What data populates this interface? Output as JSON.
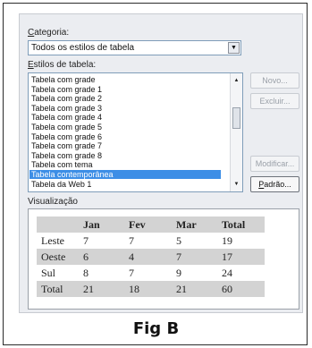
{
  "category": {
    "label_prefix": "",
    "label_mnemonic": "C",
    "label_rest": "ategoria:",
    "value": "Todos os estilos de tabela"
  },
  "styles": {
    "label_mnemonic": "E",
    "label_rest": "stilos de tabela:",
    "items": [
      "Tabela com grade",
      "Tabela com grade 1",
      "Tabela com grade 2",
      "Tabela com grade 3",
      "Tabela com grade 4",
      "Tabela com grade 5",
      "Tabela com grade 6",
      "Tabela com grade 7",
      "Tabela com grade 8",
      "Tabela com tema",
      "Tabela contemporânea",
      "Tabela da Web 1"
    ],
    "selected_index": 10
  },
  "buttons": {
    "novo": "Novo...",
    "excluir": "Excluir...",
    "modificar": "Modificar...",
    "padrao_mnemonic": "P",
    "padrao_rest": "adrão..."
  },
  "preview": {
    "label": "Visualização",
    "header": [
      "",
      "Jan",
      "Fev",
      "Mar",
      "Total"
    ],
    "rows": [
      [
        "Leste",
        "7",
        "7",
        "5",
        "19"
      ],
      [
        "Oeste",
        "6",
        "4",
        "7",
        "17"
      ],
      [
        "Sul",
        "8",
        "7",
        "9",
        "24"
      ],
      [
        "Total",
        "21",
        "18",
        "21",
        "60"
      ]
    ]
  },
  "caption": "Fig B"
}
